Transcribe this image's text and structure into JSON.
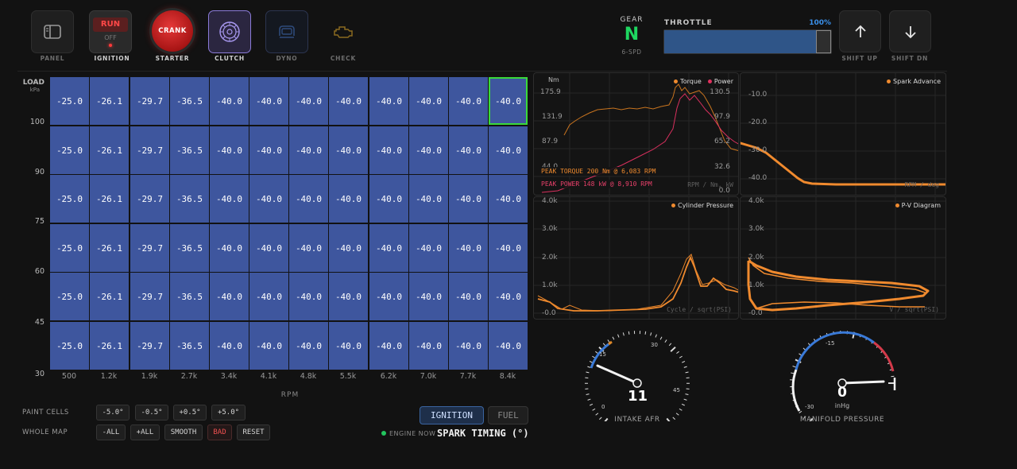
{
  "toolbar": {
    "panel_label": "PANEL",
    "ignition_run": "RUN",
    "ignition_off": "OFF",
    "ignition_label": "IGNITION",
    "crank_text": "CRANK",
    "starter_label": "STARTER",
    "clutch_label": "CLUTCH",
    "dyno_label": "DYNO",
    "check_label": "CHECK"
  },
  "gear": {
    "title": "GEAR",
    "value": "N",
    "sub": "6-SPD"
  },
  "throttle": {
    "title": "THROTTLE",
    "value_text": "100%",
    "value": 1.0
  },
  "shift": {
    "up_label": "SHIFT UP",
    "down_label": "SHIFT DN"
  },
  "map": {
    "y_title": "LOAD",
    "y_unit": "kPa",
    "y_ticks": [
      "100",
      "90",
      "75",
      "60",
      "45",
      "30"
    ],
    "x_ticks": [
      "500",
      "1.2k",
      "1.9k",
      "2.7k",
      "3.4k",
      "4.1k",
      "4.8k",
      "5.5k",
      "6.2k",
      "7.0k",
      "7.7k",
      "8.4k"
    ],
    "x_title": "RPM",
    "rows": [
      [
        "-25.0",
        "-26.1",
        "-29.7",
        "-36.5",
        "-40.0",
        "-40.0",
        "-40.0",
        "-40.0",
        "-40.0",
        "-40.0",
        "-40.0",
        "-40.0"
      ],
      [
        "-25.0",
        "-26.1",
        "-29.7",
        "-36.5",
        "-40.0",
        "-40.0",
        "-40.0",
        "-40.0",
        "-40.0",
        "-40.0",
        "-40.0",
        "-40.0"
      ],
      [
        "-25.0",
        "-26.1",
        "-29.7",
        "-36.5",
        "-40.0",
        "-40.0",
        "-40.0",
        "-40.0",
        "-40.0",
        "-40.0",
        "-40.0",
        "-40.0"
      ],
      [
        "-25.0",
        "-26.1",
        "-29.7",
        "-36.5",
        "-40.0",
        "-40.0",
        "-40.0",
        "-40.0",
        "-40.0",
        "-40.0",
        "-40.0",
        "-40.0"
      ],
      [
        "-25.0",
        "-26.1",
        "-29.7",
        "-36.5",
        "-40.0",
        "-40.0",
        "-40.0",
        "-40.0",
        "-40.0",
        "-40.0",
        "-40.0",
        "-40.0"
      ],
      [
        "-25.0",
        "-26.1",
        "-29.7",
        "-36.5",
        "-40.0",
        "-40.0",
        "-40.0",
        "-40.0",
        "-40.0",
        "-40.0",
        "-40.0",
        "-40.0"
      ]
    ],
    "selected_row": 0,
    "selected_col": 11
  },
  "controls": {
    "paint_label": "PAINT CELLS",
    "paint_buttons": [
      "-5.0°",
      "-0.5°",
      "+0.5°",
      "+5.0°"
    ],
    "whole_label": "WHOLE MAP",
    "whole_buttons": [
      "-ALL",
      "+ALL",
      "SMOOTH",
      "BAD",
      "RESET"
    ],
    "map_tabs": [
      "IGNITION",
      "FUEL"
    ],
    "engine_now": "ENGINE NOW",
    "map_title": "SPARK TIMING (°)"
  },
  "dyno_chart": {
    "y_unit": "Nm",
    "legend": [
      "Torque",
      "Power"
    ],
    "left_ticks": [
      "175.9",
      "131.9",
      "87.9",
      "44.0"
    ],
    "right_ticks": [
      "130.5",
      "97.9",
      "65.2",
      "32.6",
      "0.0"
    ],
    "axis_text": "RPM / Nm, kW",
    "peak_torque": "PEAK TORQUE 200 Nm @ 6,083 RPM",
    "peak_power": "PEAK POWER 148 kW @ 8,910 RPM"
  },
  "spark_chart": {
    "legend": "Spark Advance",
    "ticks": [
      "-10.0",
      "-20.0",
      "-30.0",
      "-40.0"
    ],
    "axis_text": "RPM / deg"
  },
  "cylinder_chart": {
    "legend": "Cylinder Pressure",
    "ticks": [
      "4.0k",
      "3.0k",
      "2.0k",
      "1.0k",
      "-0.0"
    ],
    "axis_text": "Cycle / sqrt(PSI)"
  },
  "pv_chart": {
    "legend": "P-V Diagram",
    "ticks": [
      "4.0k",
      "3.0k",
      "2.0k",
      "1.0k",
      "-0.0"
    ],
    "axis_text": "V / sqrt(PSI)"
  },
  "afr_gauge": {
    "value": "11",
    "label": "INTAKE AFR",
    "ticks": [
      "0",
      "15",
      "30",
      "45"
    ]
  },
  "map_gauge": {
    "value": "0",
    "unit": "inHg",
    "label": "MANIFOLD PRESSURE",
    "ticks": [
      "-30",
      "-15",
      "0"
    ]
  },
  "colors": {
    "cell": "#3e569e",
    "selected": "#3ad93a",
    "torque": "#ef8a2e",
    "power": "#e0305e",
    "accent": "#2f7ad6"
  }
}
